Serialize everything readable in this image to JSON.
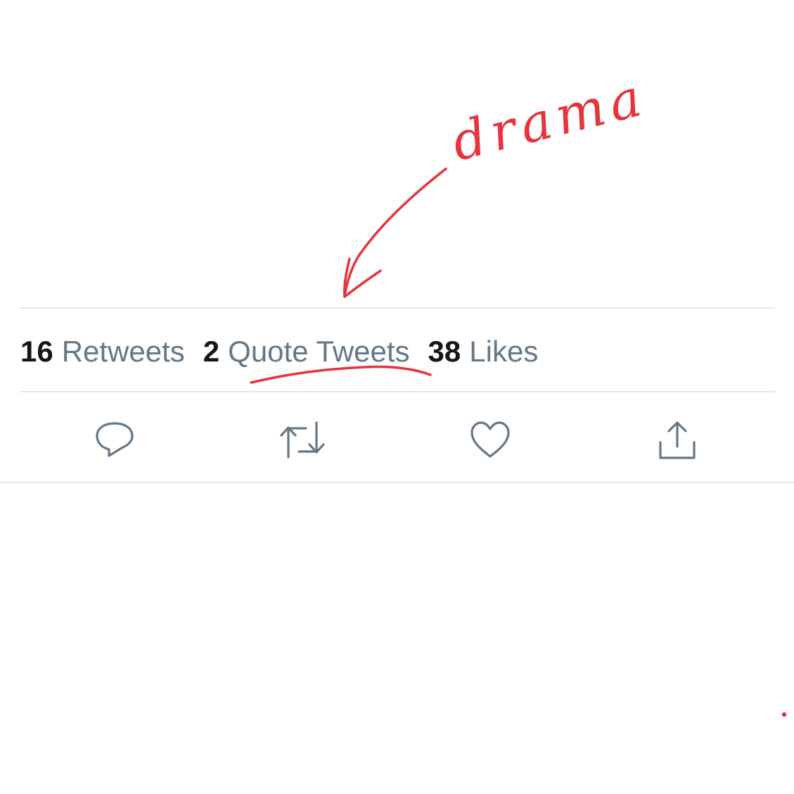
{
  "stats": {
    "retweets_count": "16",
    "retweets_label": "Retweets",
    "quotes_count": "2",
    "quotes_label": "Quote Tweets",
    "likes_count": "38",
    "likes_label": "Likes"
  },
  "actions": [
    {
      "icon": "reply-icon"
    },
    {
      "icon": "retweet-icon"
    },
    {
      "icon": "like-icon"
    },
    {
      "icon": "share-icon"
    }
  ],
  "annotation": {
    "text": "drama",
    "color": "#e8323c"
  },
  "colors": {
    "count_text": "#14171a",
    "label_text": "#657786",
    "icon": "#657786",
    "divider": "#e3e6ea"
  }
}
